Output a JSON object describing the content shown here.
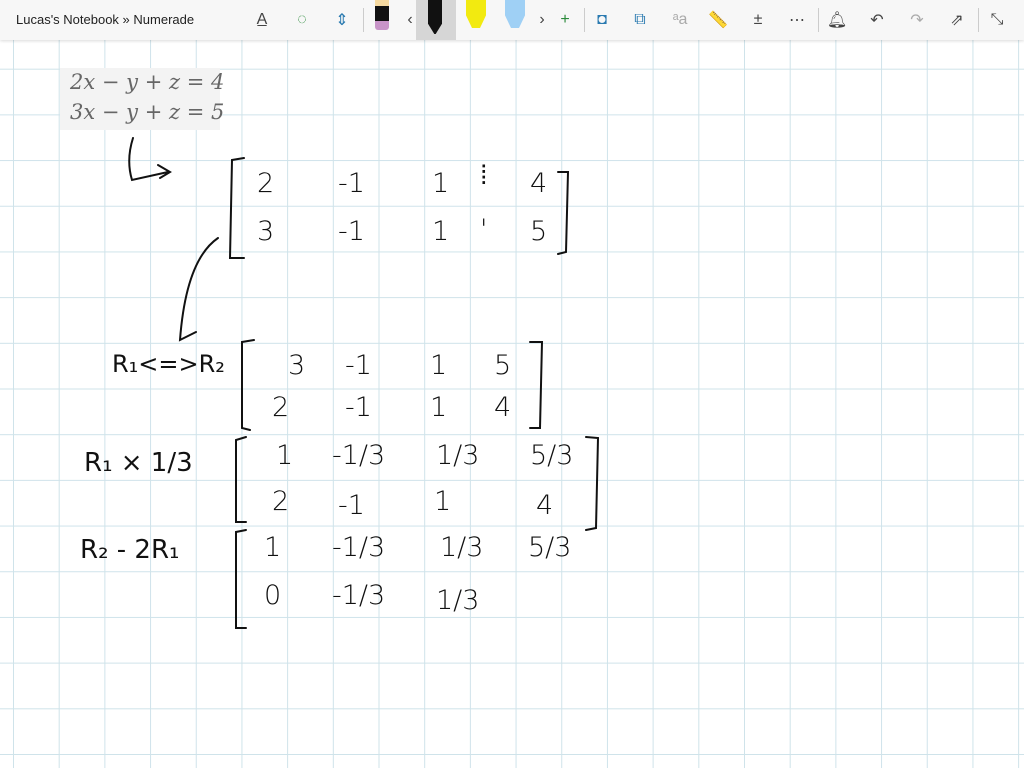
{
  "window": {
    "title": "Lucas's Notebook » Numerade"
  },
  "toolbar": {
    "icons": [
      "lasso-text-icon",
      "lasso-select-icon",
      "add-space-icon",
      "pen-pink",
      "pen-black",
      "highlighter-yellow",
      "highlighter-blue",
      "add-pen-icon",
      "ink-to-shape-icon",
      "ink-to-text-icon",
      "ink-to-math-icon",
      "ruler-icon",
      "math-icon",
      "more-icon",
      "bell-icon",
      "undo-icon",
      "redo-icon",
      "share-icon",
      "collapse-icon"
    ]
  },
  "colors": {
    "pen_pink": "#c894c8",
    "pen_black": "#111111",
    "hl_yellow": "#ffff00",
    "hl_blue": "#9fd0f5"
  },
  "equations": [
    "2x − y + z = 4",
    "3x − y + z = 5"
  ],
  "matrices": [
    {
      "label": "",
      "rows": [
        [
          "2",
          "-1",
          "1",
          "⁞",
          "4"
        ],
        [
          "3",
          "-1",
          "1",
          "'",
          "5"
        ]
      ]
    },
    {
      "label": "R₁<=>R₂",
      "rows": [
        [
          "3",
          "-1",
          "1",
          "5"
        ],
        [
          "2",
          "-1",
          "1",
          "4"
        ]
      ]
    },
    {
      "label": "R₁ × 1/3",
      "rows": [
        [
          "1",
          "-1/3",
          "1/3",
          "5/3"
        ],
        [
          "2",
          "-1",
          "1",
          "4"
        ]
      ]
    },
    {
      "label": "R₂ - 2R₁",
      "rows": [
        [
          "1",
          "-1/3",
          "1/3",
          "5/3"
        ],
        [
          "0",
          "-1/3",
          "1/3",
          ""
        ]
      ]
    }
  ]
}
